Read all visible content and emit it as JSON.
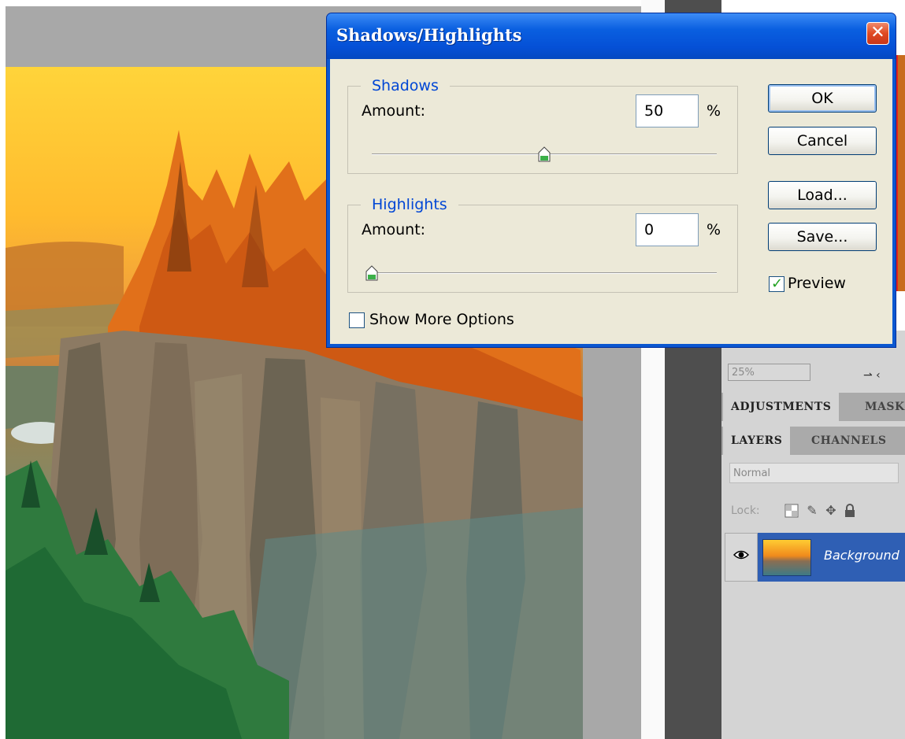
{
  "dialog": {
    "title": "Shadows/Highlights",
    "shadows": {
      "legend": "Shadows",
      "amount_label": "Amount:",
      "amount_value": "50",
      "unit": "%",
      "slider_fraction": 0.5
    },
    "highlights": {
      "legend": "Highlights",
      "amount_label": "Amount:",
      "amount_value": "0",
      "unit": "%",
      "slider_fraction": 0.0
    },
    "buttons": {
      "ok": "OK",
      "cancel": "Cancel",
      "load": "Load...",
      "save": "Save..."
    },
    "preview": {
      "label": "Preview",
      "checked": true
    },
    "show_more": {
      "label": "Show More Options",
      "checked": false
    }
  },
  "panels": {
    "zoom_value": "25%",
    "adjustments_tabs": [
      "ADJUSTMENTS",
      "MASKS"
    ],
    "layers_tabs": [
      "LAYERS",
      "CHANNELS"
    ],
    "blend_mode": "Normal",
    "lock_label": "Lock:",
    "layer": {
      "name": "Background",
      "visible": true
    }
  },
  "colors": {
    "title_bar": "#0a5fe0",
    "dialog_bg": "#ece9d8",
    "legend_text": "#0046d5",
    "selected_layer": "#2f5fb4",
    "panel_bg": "#d4d4d4"
  },
  "icons": [
    "close-icon",
    "eye-icon",
    "lock-transparent-icon",
    "lock-brush-icon",
    "lock-move-icon",
    "lock-all-icon",
    "checkmark-icon"
  ]
}
